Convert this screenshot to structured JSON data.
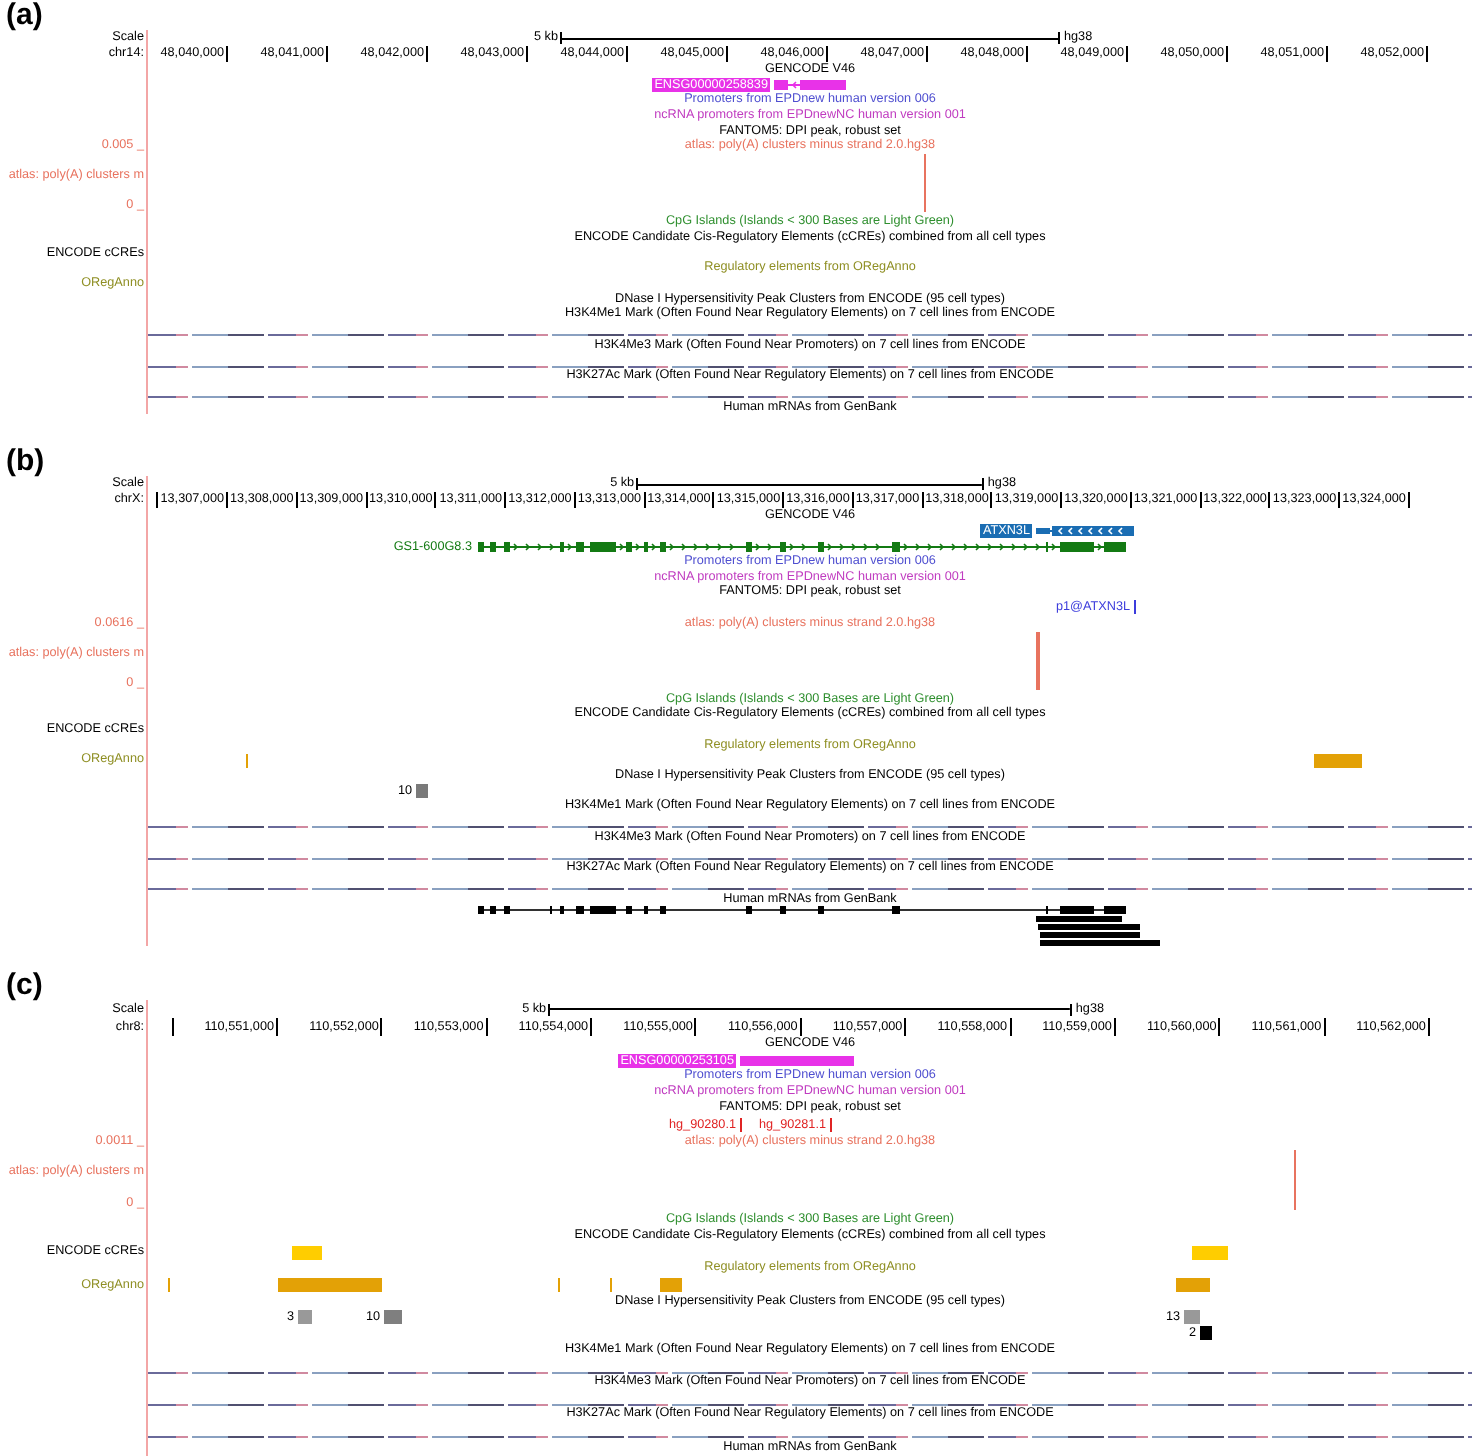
{
  "panels": [
    {
      "label": "(a)",
      "ruler": {
        "scale_label": "Scale",
        "chrom": "chr14:",
        "scale_text": "5 kb",
        "assembly": "hg38",
        "positions": [
          "48,040,000",
          "48,041,000",
          "48,042,000",
          "48,043,000",
          "48,044,000",
          "48,045,000",
          "48,046,000",
          "48,047,000",
          "48,048,000",
          "48,049,000",
          "48,050,000",
          "48,051,000",
          "48,052,000"
        ]
      },
      "tracks": [
        {
          "kind": "items",
          "title": "GENCODE V46",
          "color": "#000000",
          "rows": [
            [
              {
                "kind": "gene",
                "name": "ENSG00000258839",
                "color": "#e832e8",
                "highlighted": true,
                "reverse_strand": true
              }
            ]
          ]
        },
        {
          "kind": "items",
          "title": "Promoters from EPDnew human version 006",
          "color": "#4f4fd0"
        },
        {
          "kind": "items",
          "title": "ncRNA promoters from EPDnewNC human version 001",
          "color": "#c03cc0"
        },
        {
          "kind": "items",
          "title": "FANTOM5: DPI peak, robust set",
          "color": "#000000"
        },
        {
          "kind": "graph",
          "title": "atlas: poly(A) clusters minus strand 2.0.hg38",
          "color": "#e8735f",
          "side_label": "atlas: poly(A) clusters m",
          "scale_max": "0.005 _",
          "scale_min": "0 _",
          "items": [
            {
              "kind": "peak"
            }
          ]
        },
        {
          "kind": "items",
          "title": "CpG Islands (Islands < 300 Bases are Light Green)",
          "color": "#2f8f2f"
        },
        {
          "kind": "items",
          "title": "ENCODE Candidate Cis-Regulatory Elements (cCREs) combined from all cell types",
          "color": "#000000",
          "side_label": "ENCODE cCREs"
        },
        {
          "kind": "items",
          "title": "Regulatory elements from ORegAnno",
          "color": "#8f8f24",
          "side_label": "ORegAnno"
        },
        {
          "kind": "items",
          "title": "DNase I Hypersensitivity Peak Clusters from ENCODE (95 cell types)",
          "color": "#000000"
        },
        {
          "kind": "signal",
          "title": "H3K4Me1 Mark (Often Found Near Regulatory Elements) on 7 cell lines from ENCODE",
          "color": "#000000"
        },
        {
          "kind": "signal",
          "title": "H3K4Me3 Mark (Often Found Near Promoters) on 7 cell lines from ENCODE",
          "color": "#000000"
        },
        {
          "kind": "signal",
          "title": "H3K27Ac Mark (Often Found Near Regulatory Elements) on 7 cell lines from ENCODE",
          "color": "#000000"
        },
        {
          "kind": "items",
          "title": "Human mRNAs from GenBank",
          "color": "#000000"
        }
      ]
    },
    {
      "label": "(b)",
      "ruler": {
        "scale_label": "Scale",
        "chrom": "chrX:",
        "scale_text": "5 kb",
        "assembly": "hg38",
        "positions": [
          "13,307,000",
          "13,308,000",
          "13,309,000",
          "13,310,000",
          "13,311,000",
          "13,312,000",
          "13,313,000",
          "13,314,000",
          "13,315,000",
          "13,316,000",
          "13,317,000",
          "13,318,000",
          "13,319,000",
          "13,320,000",
          "13,321,000",
          "13,322,000",
          "13,323,000",
          "13,324,000"
        ]
      },
      "tracks": [
        {
          "kind": "items",
          "title": "GENCODE V46",
          "color": "#000000",
          "rows": [
            [
              {
                "kind": "gene",
                "name": "ATXN3L",
                "color": "#1a6db3",
                "highlighted": true,
                "reverse_strand": true
              }
            ],
            [
              {
                "kind": "gene",
                "name": "GS1-600G8.3",
                "color": "#137a13",
                "highlighted": false,
                "reverse_strand": false
              }
            ]
          ]
        },
        {
          "kind": "items",
          "title": "Promoters from EPDnew human version 006",
          "color": "#4f4fd0"
        },
        {
          "kind": "items",
          "title": "ncRNA promoters from EPDnewNC human version 001",
          "color": "#c03cc0"
        },
        {
          "kind": "items",
          "title": "FANTOM5: DPI peak, robust set",
          "color": "#000000",
          "rows": [
            [
              {
                "kind": "site",
                "name": "p1@ATXN3L",
                "color": "#3c3cdc"
              }
            ]
          ]
        },
        {
          "kind": "graph",
          "title": "atlas: poly(A) clusters minus strand 2.0.hg38",
          "color": "#e8735f",
          "side_label": "atlas: poly(A) clusters m",
          "scale_max": "0.0616 _",
          "scale_min": "0 _",
          "items": [
            {
              "kind": "peak"
            }
          ]
        },
        {
          "kind": "items",
          "title": "CpG Islands (Islands < 300 Bases are Light Green)",
          "color": "#2f8f2f"
        },
        {
          "kind": "items",
          "title": "ENCODE Candidate Cis-Regulatory Elements (cCREs) combined from all cell types",
          "color": "#000000",
          "side_label": "ENCODE cCREs"
        },
        {
          "kind": "items",
          "title": "Regulatory elements from ORegAnno",
          "color": "#8f8f24",
          "side_label": "ORegAnno",
          "rows": [
            [
              {
                "kind": "tick",
                "color": "#e3a106"
              },
              {
                "kind": "block",
                "color": "#e3a106"
              }
            ]
          ]
        },
        {
          "kind": "items",
          "title": "DNase I Hypersensitivity Peak Clusters from ENCODE (95 cell types)",
          "color": "#000000",
          "rows": [
            [
              {
                "kind": "cluster",
                "score": "10",
                "color": "#7a7a7a"
              }
            ]
          ]
        },
        {
          "kind": "signal",
          "title": "H3K4Me1 Mark (Often Found Near Regulatory Elements) on 7 cell lines from ENCODE",
          "color": "#000000"
        },
        {
          "kind": "signal",
          "title": "H3K4Me3 Mark (Often Found Near Promoters) on 7 cell lines from ENCODE",
          "color": "#000000"
        },
        {
          "kind": "signal",
          "title": "H3K27Ac Mark (Often Found Near Regulatory Elements) on 7 cell lines from ENCODE",
          "color": "#000000"
        },
        {
          "kind": "items",
          "title": "Human mRNAs from GenBank",
          "color": "#000000",
          "rows": [
            [
              {
                "kind": "spliced"
              }
            ],
            [
              {
                "kind": "bar"
              }
            ],
            [
              {
                "kind": "bar"
              }
            ],
            [
              {
                "kind": "bar"
              }
            ],
            [
              {
                "kind": "bar"
              }
            ]
          ]
        }
      ]
    },
    {
      "label": "(c)",
      "ruler": {
        "scale_label": "Scale",
        "chrom": "chr8:",
        "scale_text": "5 kb",
        "assembly": "hg38",
        "positions": [
          "110,551,000",
          "110,552,000",
          "110,553,000",
          "110,554,000",
          "110,555,000",
          "110,556,000",
          "110,557,000",
          "110,558,000",
          "110,559,000",
          "110,560,000",
          "110,561,000",
          "110,562,000"
        ]
      },
      "tracks": [
        {
          "kind": "items",
          "title": "GENCODE V46",
          "color": "#000000",
          "rows": [
            [
              {
                "kind": "gene",
                "name": "ENSG00000253105",
                "color": "#e832e8",
                "highlighted": true
              }
            ]
          ]
        },
        {
          "kind": "items",
          "title": "Promoters from EPDnew human version 006",
          "color": "#4f4fd0"
        },
        {
          "kind": "items",
          "title": "ncRNA promoters from EPDnewNC human version 001",
          "color": "#c03cc0"
        },
        {
          "kind": "items",
          "title": "FANTOM5: DPI peak, robust set",
          "color": "#000000",
          "rows": [
            [
              {
                "kind": "site",
                "name": "hg_90280.1",
                "color": "#e02424"
              },
              {
                "kind": "site",
                "name": "hg_90281.1",
                "color": "#e02424"
              }
            ]
          ]
        },
        {
          "kind": "graph",
          "title": "atlas: poly(A) clusters minus strand 2.0.hg38",
          "color": "#e8735f",
          "side_label": "atlas: poly(A) clusters m",
          "scale_max": "0.0011 _",
          "scale_min": "0 _",
          "items": [
            {
              "kind": "peak"
            }
          ]
        },
        {
          "kind": "items",
          "title": "CpG Islands (Islands < 300 Bases are Light Green)",
          "color": "#2f8f2f"
        },
        {
          "kind": "items",
          "title": "ENCODE Candidate Cis-Regulatory Elements (cCREs) combined from all cell types",
          "color": "#000000",
          "side_label": "ENCODE cCREs",
          "rows": [
            [
              {
                "kind": "block",
                "color": "#ffcd00"
              },
              {
                "kind": "block",
                "color": "#ffcd00"
              }
            ]
          ]
        },
        {
          "kind": "items",
          "title": "Regulatory elements from ORegAnno",
          "color": "#8f8f24",
          "side_label": "ORegAnno",
          "rows": [
            [
              {
                "kind": "tick",
                "color": "#e3a106"
              },
              {
                "kind": "block",
                "color": "#e3a106"
              },
              {
                "kind": "tick",
                "color": "#e3a106"
              },
              {
                "kind": "tick",
                "color": "#e3a106"
              },
              {
                "kind": "block",
                "color": "#e3a106"
              },
              {
                "kind": "block",
                "color": "#e3a106"
              }
            ]
          ]
        },
        {
          "kind": "items",
          "title": "DNase I Hypersensitivity Peak Clusters from ENCODE (95 cell types)",
          "color": "#000000",
          "rows": [
            [
              {
                "kind": "cluster",
                "score": "3",
                "color": "#999999"
              },
              {
                "kind": "cluster",
                "score": "10",
                "color": "#7f7f7f"
              },
              {
                "kind": "cluster",
                "score": "13",
                "color": "#999999"
              }
            ],
            [
              {
                "kind": "cluster",
                "score": "2",
                "color": "#000000"
              }
            ]
          ]
        },
        {
          "kind": "signal",
          "title": "H3K4Me1 Mark (Often Found Near Regulatory Elements) on 7 cell lines from ENCODE",
          "color": "#000000"
        },
        {
          "kind": "signal",
          "title": "H3K4Me3 Mark (Often Found Near Promoters) on 7 cell lines from ENCODE",
          "color": "#000000"
        },
        {
          "kind": "signal",
          "title": "H3K27Ac Mark (Often Found Near Regulatory Elements) on 7 cell lines from ENCODE",
          "color": "#000000"
        },
        {
          "kind": "items",
          "title": "Human mRNAs from GenBank",
          "color": "#000000"
        }
      ]
    }
  ]
}
